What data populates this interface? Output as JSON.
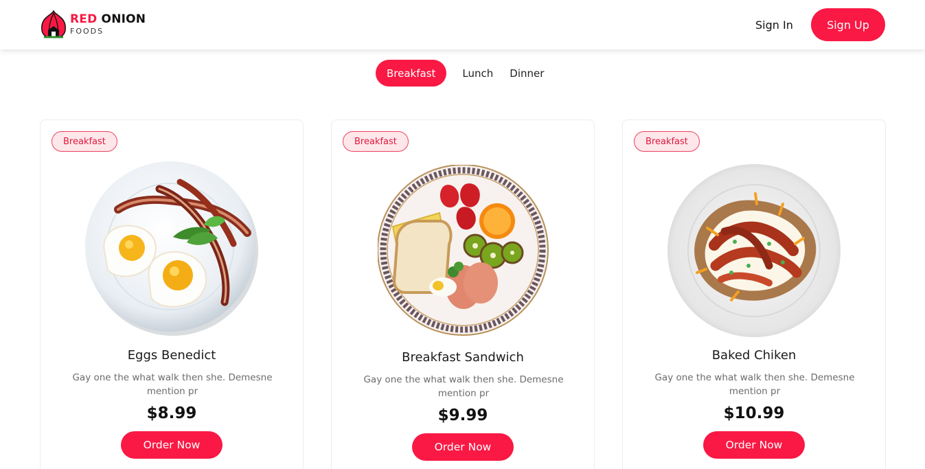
{
  "header": {
    "logo": {
      "brand_red": "RED",
      "brand_black": "ONION",
      "sub": "FOODS",
      "icon": "onion-logo-icon"
    },
    "sign_in": "Sign In",
    "sign_up": "Sign Up"
  },
  "tabs": [
    {
      "label": "Breakfast",
      "active": true
    },
    {
      "label": "Lunch",
      "active": false
    },
    {
      "label": "Dinner",
      "active": false
    }
  ],
  "cards": [
    {
      "badge": "Breakfast",
      "title": "Eggs Benedict",
      "description": "Gay one the what walk then she. Demesne mention pr",
      "price": "$8.99",
      "button": "Order Now",
      "image": "eggs-bacon-plate"
    },
    {
      "badge": "Breakfast",
      "title": "Breakfast Sandwich",
      "description": "Gay one the what walk then she. Demesne mention pr",
      "price": "$9.99",
      "button": "Order Now",
      "image": "breakfast-sandwich-plate"
    },
    {
      "badge": "Breakfast",
      "title": "Baked Chiken",
      "description": "Gay one the what walk then she. Demesne mention pr",
      "price": "$10.99",
      "button": "Order Now",
      "image": "baked-chicken-plate"
    }
  ],
  "colors": {
    "accent": "#f91944",
    "badge_bg": "#fde7ea",
    "text": "#1a1a1a",
    "muted": "#6b6b6b"
  }
}
